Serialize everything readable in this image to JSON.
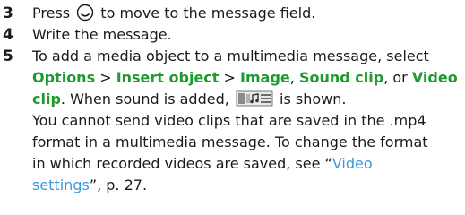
{
  "steps": [
    {
      "number": "3",
      "before_icon": "Press",
      "icon": "navigation-key-icon",
      "after_icon": "to move to the message field."
    },
    {
      "number": "4",
      "text": "Write the message."
    },
    {
      "number": "5",
      "line1": "To add a media object to a multimedia message, select",
      "options": "Options",
      "gt1": ">",
      "insert_object": "Insert object",
      "gt2": ">",
      "image": "Image",
      "comma1": ",",
      "sound_clip": "Sound clip",
      "or": ", or",
      "video_part1": "Video",
      "video_part2": "clip",
      "when_sound": ". When sound is added,",
      "sound_icon": "sound-clip-icon",
      "is_shown": "is shown.",
      "para2_line1": "You cannot send video clips that are saved in the .mp4",
      "para2_line2": "format in a multimedia message. To change the format",
      "para2_line3_a": "in which recorded videos are saved, see “",
      "link_part1": "Video",
      "link_part2": "settings",
      "para2_line4_b": "”, p. 27."
    }
  ]
}
